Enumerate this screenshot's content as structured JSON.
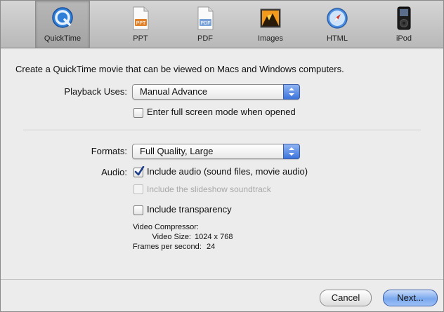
{
  "toolbar": {
    "items": [
      {
        "label": "QuickTime",
        "icon": "quicktime-icon",
        "selected": true
      },
      {
        "label": "PPT",
        "icon": "ppt-file-icon"
      },
      {
        "label": "PDF",
        "icon": "pdf-file-icon"
      },
      {
        "label": "Images",
        "icon": "images-icon"
      },
      {
        "label": "HTML",
        "icon": "compass-icon"
      },
      {
        "label": "iPod",
        "icon": "ipod-icon"
      }
    ],
    "ppt_badge": "PPT",
    "pdf_badge": "PDF"
  },
  "description": "Create a QuickTime movie that can be viewed on Macs and Windows computers.",
  "playback": {
    "label": "Playback Uses:",
    "value": "Manual Advance",
    "fullscreen_label": "Enter full screen mode when opened",
    "fullscreen_checked": false
  },
  "formats": {
    "label": "Formats:",
    "value": "Full Quality, Large"
  },
  "audio": {
    "label": "Audio:",
    "include_audio_label": "Include audio (sound files, movie audio)",
    "include_audio_checked": true,
    "soundtrack_label": "Include the slideshow soundtrack",
    "soundtrack_enabled": false
  },
  "transparency": {
    "label": "Include transparency",
    "checked": false
  },
  "info": {
    "compressor_label": "Video Compressor:",
    "compressor_value": "",
    "size_label": "Video Size:",
    "size_value": "1024 x 768",
    "fps_label": "Frames per second:",
    "fps_value": "24"
  },
  "buttons": {
    "cancel": "Cancel",
    "next": "Next..."
  },
  "colors": {
    "default_button": "#7aa8ee",
    "popup_arrow": "#3d74dc"
  }
}
